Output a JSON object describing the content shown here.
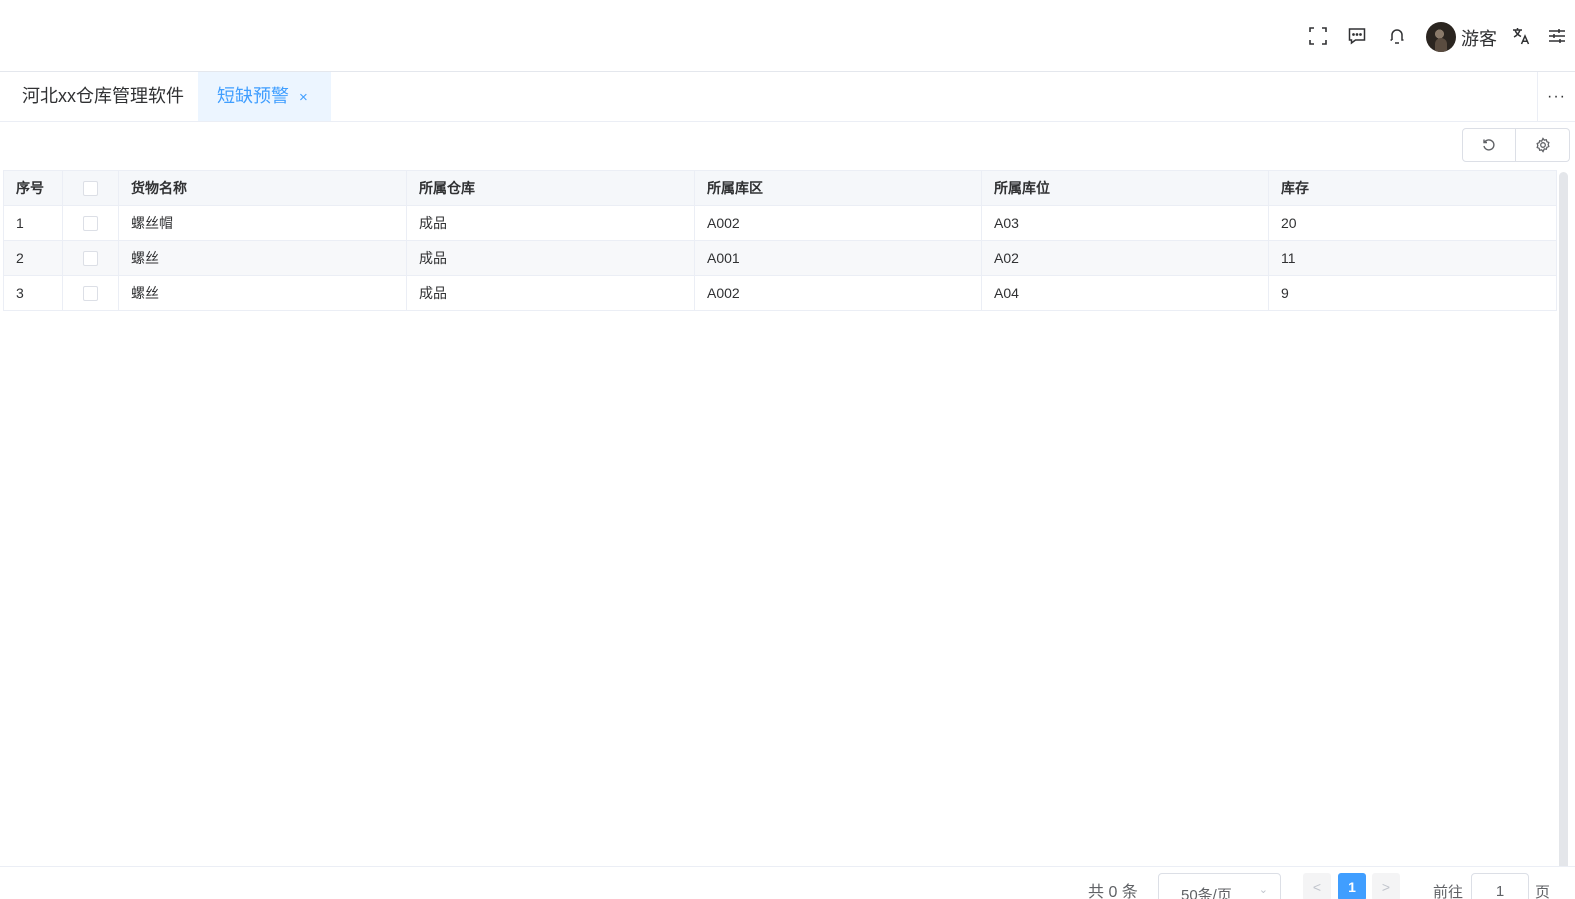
{
  "header": {
    "username": "游客",
    "icons": [
      "fullscreen-icon",
      "message-icon",
      "bell-icon",
      "translate-icon",
      "settings-sliders-icon"
    ]
  },
  "tabs": [
    {
      "label": "河北xx仓库管理软件",
      "active": false
    },
    {
      "label": "短缺预警",
      "active": true,
      "close": "×"
    }
  ],
  "tab_more": "···",
  "table": {
    "columns": [
      "序号",
      "",
      "货物名称",
      "所属仓库",
      "所属库区",
      "所属库位",
      "库存"
    ],
    "rows": [
      {
        "index": "1",
        "name": "螺丝帽",
        "warehouse": "成品",
        "area": "A002",
        "location": "A03",
        "stock": "20"
      },
      {
        "index": "2",
        "name": "螺丝",
        "warehouse": "成品",
        "area": "A001",
        "location": "A02",
        "stock": "11"
      },
      {
        "index": "3",
        "name": "螺丝",
        "warehouse": "成品",
        "area": "A002",
        "location": "A04",
        "stock": "9"
      }
    ]
  },
  "pagination": {
    "total": "共 0 条",
    "page_size": "50条/页",
    "prev": "<",
    "current": "1",
    "next": ">",
    "goto_label": "前往",
    "goto_value": "1",
    "goto_suffix": "页"
  }
}
